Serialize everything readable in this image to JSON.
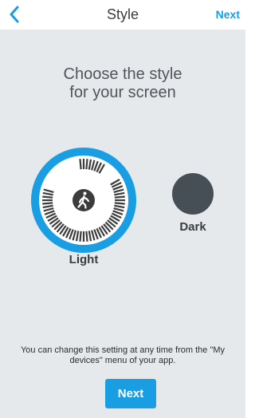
{
  "navbar": {
    "title": "Style",
    "next_label": "Next"
  },
  "main": {
    "heading_line1": "Choose the style",
    "heading_line2": "for your screen"
  },
  "options": {
    "light_label": "Light",
    "dark_label": "Dark",
    "selected": "Light"
  },
  "footer": {
    "info_text": "You can change this setting at any time from the \"My devices\" menu of your app.",
    "next_label": "Next"
  },
  "colors": {
    "accent": "#1a9ee3",
    "background": "#e6e9ec",
    "dark_swatch": "#464f56",
    "text": "#3c3c3c"
  },
  "icons": {
    "back": "chevron-left-icon",
    "activity": "walking-person-icon"
  }
}
